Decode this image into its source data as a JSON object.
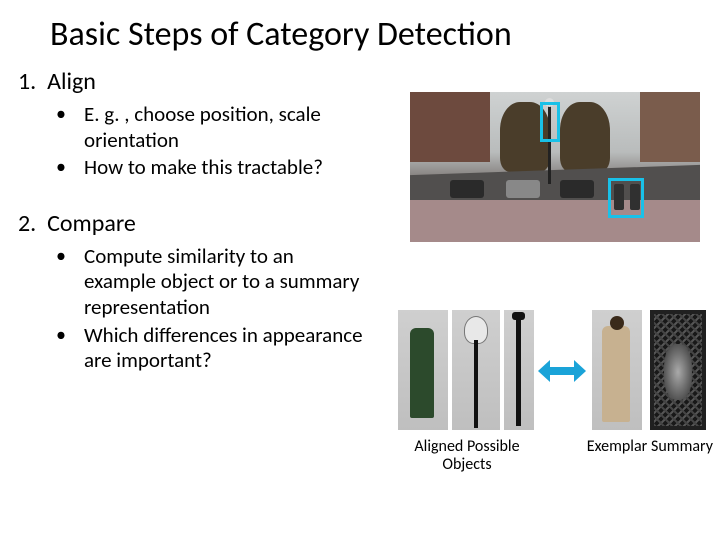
{
  "title": "Basic Steps of Category Detection",
  "sections": [
    {
      "num": "1.",
      "heading": "Align",
      "bullets": [
        "E. g. , choose position, scale orientation",
        "How to make this tractable?"
      ]
    },
    {
      "num": "2.",
      "heading": "Compare",
      "bullets": [
        "Compute similarity to an example object or to a summary representation",
        "Which differences in appearance are important?"
      ]
    }
  ],
  "captions": {
    "aligned": "Aligned Possible Objects",
    "exemplar": "Exemplar",
    "summary": "Summary"
  }
}
